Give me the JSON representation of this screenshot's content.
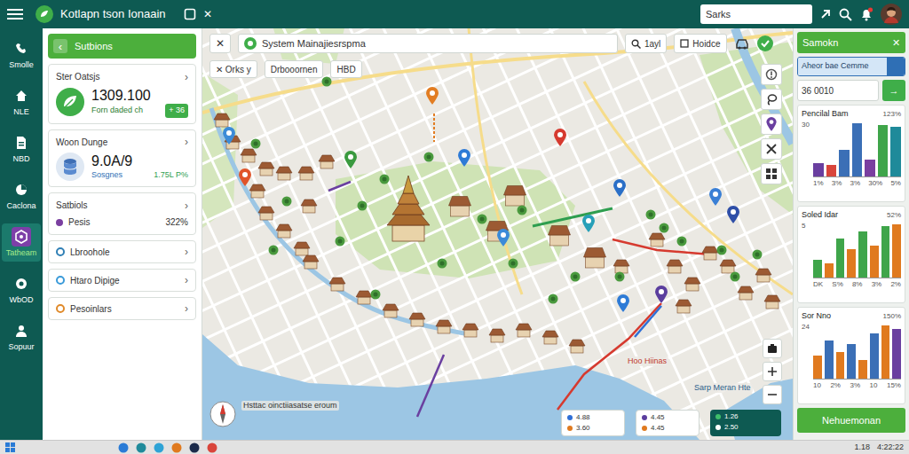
{
  "topbar": {
    "title": "Kotlapn tson Ionaain",
    "close": "✕",
    "search": {
      "value": "Sarks"
    }
  },
  "sidebar": {
    "items": [
      {
        "label": "Smolle",
        "selected": false
      },
      {
        "label": "NLE",
        "selected": false
      },
      {
        "label": "NBD",
        "selected": false
      },
      {
        "label": "Caclona",
        "selected": false
      },
      {
        "label": "Tatheam",
        "selected": true
      },
      {
        "label": "WbOD",
        "selected": false
      },
      {
        "label": "Sopuur",
        "selected": false
      }
    ]
  },
  "left_panel": {
    "header": {
      "chevron": "‹",
      "title": "Sutbions"
    },
    "stats": [
      {
        "kind": "leaf",
        "title": "Ster Oatsjs",
        "chevron": "›",
        "value": "1309.100",
        "caption": "Forn daded ch",
        "badge": "+ 36"
      },
      {
        "kind": "stack",
        "title": "Woon Dunge",
        "chevron": "›",
        "value": "9.0A/9",
        "caption": "Sosgnes",
        "badge": "1.75L P%"
      }
    ],
    "section": {
      "title": "Satbiols",
      "chevron": "›",
      "rows": [
        {
          "label": "Pesis",
          "value": "322%",
          "color": "#7b3fa0"
        }
      ]
    },
    "links": [
      {
        "label": "Lbroohole",
        "chevron": "›",
        "color": "#2f7fb5"
      },
      {
        "label": "Htaro Dipige",
        "chevron": "›",
        "color": "#3a9ad9"
      },
      {
        "label": "Pesoinlars",
        "chevron": "›",
        "color": "#e08a2a"
      }
    ]
  },
  "map": {
    "toolbar": {
      "close": "✕",
      "search": "System Mainajiesrspma",
      "find": "1ayl",
      "layer": "Hoidce"
    },
    "chips": [
      "✕ Orks y",
      "Drbooornen",
      "HBD"
    ],
    "pins": [
      {
        "color": "#e27d22"
      },
      {
        "color": "#d63a2f"
      },
      {
        "color": "#3a9a3f"
      },
      {
        "color": "#2e7bd6"
      },
      {
        "color": "#3b8bd8"
      },
      {
        "color": "#e0542a"
      },
      {
        "color": "#2a6fc7"
      },
      {
        "color": "#3a7fd5"
      },
      {
        "color": "#2f4fa8"
      },
      {
        "color": "#27a0b8"
      },
      {
        "color": "#3b8bd8"
      },
      {
        "color": "#5b3e9e"
      },
      {
        "color": "#2e7bd6"
      }
    ],
    "labels": [
      {
        "text": "Hsttac oinctiiasatse eroum",
        "color": "#333333"
      },
      {
        "text": "Hoo Hiinas",
        "color": "#c0392b"
      },
      {
        "text": "Sarp Meran Hte",
        "color": "#2a5d8a"
      }
    ],
    "legend": [
      {
        "kind": "light",
        "rows": [
          {
            "text": "4.88",
            "color": "#2f6fd6"
          },
          {
            "text": "3.60",
            "color": "#e07a1f"
          }
        ]
      },
      {
        "kind": "light",
        "rows": [
          {
            "text": "4.45",
            "color": "#5b3e9e"
          },
          {
            "text": "4.45",
            "color": "#e07a1f"
          }
        ]
      },
      {
        "kind": "dark",
        "rows": [
          {
            "text": "1.26",
            "color": "#3fbf6a"
          },
          {
            "text": "2.50",
            "color": "#ffffff"
          }
        ]
      }
    ]
  },
  "right_panel": {
    "title": "Samokn",
    "close": "✕",
    "tab": {
      "label": "Aheor bae Cemme",
      "selected": true
    },
    "field": {
      "value": "36 0010",
      "button": "→"
    },
    "charts": [
      {
        "title": "Pencilal Bam",
        "reading": "123%",
        "tick": "30",
        "x_labels": [
          "1%",
          "3%",
          "3%",
          "30%",
          "5%"
        ],
        "bars": [
          {
            "value": 7,
            "color": "#6a3fa0"
          },
          {
            "value": 6,
            "color": "#d9453b"
          },
          {
            "value": 14,
            "color": "#3b6fb6"
          },
          {
            "value": 28,
            "color": "#3b6fb6"
          },
          {
            "value": 9,
            "color": "#7a3fa0"
          },
          {
            "value": 27,
            "color": "#3fa54a"
          },
          {
            "value": 26,
            "color": "#1f8a9a"
          }
        ]
      },
      {
        "title": "Soled Idar",
        "reading": "52%",
        "tick": "5",
        "x_labels": [
          "DK",
          "S%",
          "8%",
          "3%",
          "2%"
        ],
        "bars": [
          {
            "value": 10,
            "color": "#3fa54a"
          },
          {
            "value": 8,
            "color": "#e07a1f"
          },
          {
            "value": 22,
            "color": "#3fa54a"
          },
          {
            "value": 16,
            "color": "#e07a1f"
          },
          {
            "value": 26,
            "color": "#3fa54a"
          },
          {
            "value": 18,
            "color": "#e07a1f"
          },
          {
            "value": 29,
            "color": "#3fa54a"
          },
          {
            "value": 30,
            "color": "#e07a1f"
          }
        ]
      },
      {
        "title": "Sor Nno",
        "reading": "150%",
        "tick": "24",
        "x_labels": [
          "10",
          "2%",
          "3%",
          "10",
          "15%"
        ],
        "bars": [
          {
            "value": 12,
            "color": "#e07a1f"
          },
          {
            "value": 20,
            "color": "#3b6fb6"
          },
          {
            "value": 14,
            "color": "#e07a1f"
          },
          {
            "value": 18,
            "color": "#3b6fb6"
          },
          {
            "value": 10,
            "color": "#e07a1f"
          },
          {
            "value": 24,
            "color": "#3b6fb6"
          },
          {
            "value": 28,
            "color": "#e07a1f"
          },
          {
            "value": 26,
            "color": "#6a3fa0"
          }
        ]
      }
    ],
    "action": "Nehuemonan"
  },
  "taskbar": {
    "date": "1.18",
    "time": "4:22:22"
  }
}
